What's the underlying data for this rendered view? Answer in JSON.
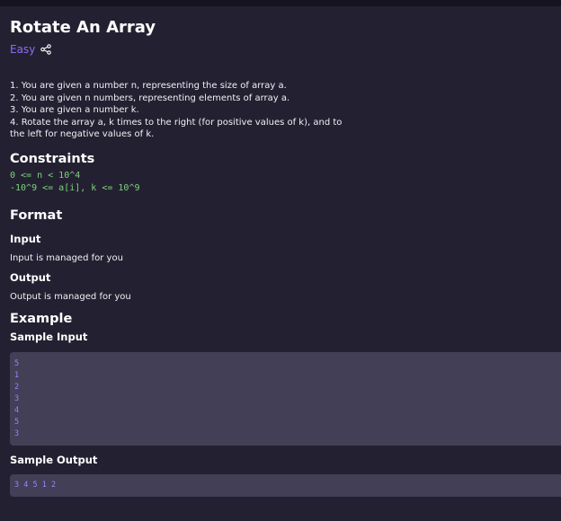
{
  "problem": {
    "title": "Rotate An Array",
    "difficulty": "Easy",
    "difficulty_color": "#8f6cf2",
    "share_icon": "share-icon"
  },
  "description": [
    "1. You are given a number n, representing the size of array a.",
    "2. You are given n numbers, representing elements of array a.",
    "3. You are given a number k.",
    "4. Rotate the array a, k times to the right (for positive values of k), and to",
    "the left for negative values of k."
  ],
  "constraints": {
    "heading": "Constraints",
    "lines": [
      "0 <= n < 10^4",
      "-10^9 <= a[i], k <= 10^9"
    ],
    "color": "#7dd37b"
  },
  "format": {
    "heading": "Format",
    "input_heading": "Input",
    "input_text": "Input is managed for you",
    "output_heading": "Output",
    "output_text": "Output is managed for you"
  },
  "example": {
    "heading": "Example",
    "sample_input_heading": "Sample Input",
    "sample_input_lines": [
      "5",
      "1",
      "2",
      "3",
      "4",
      "5",
      "3"
    ],
    "sample_output_heading": "Sample Output",
    "sample_output": "3 4 5 1 2",
    "code_color": "#9b85f5",
    "code_bg": "#423f57"
  }
}
